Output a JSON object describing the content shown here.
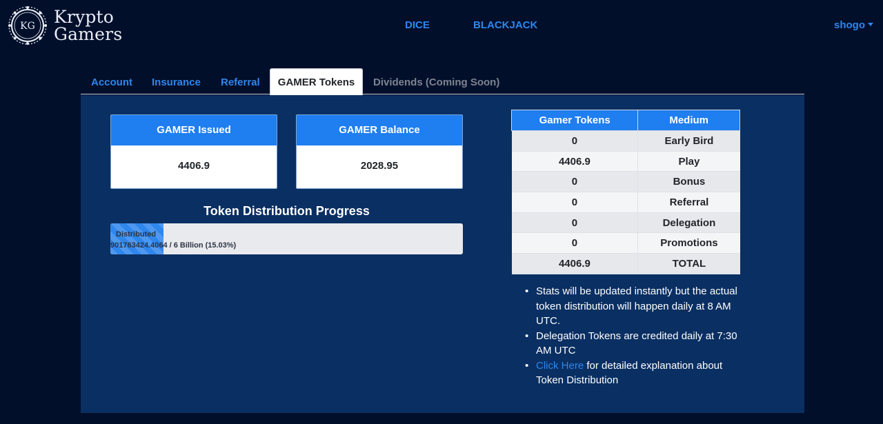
{
  "brand": {
    "badge": "KG",
    "line1": "Krypto",
    "line2": "Gamers"
  },
  "nav": {
    "dice": "DICE",
    "blackjack": "BLACKJACK",
    "user": "shogo"
  },
  "tabs": [
    {
      "label": "Account",
      "active": false
    },
    {
      "label": "Insurance",
      "active": false
    },
    {
      "label": "Referral",
      "active": false
    },
    {
      "label": "GAMER Tokens",
      "active": true
    },
    {
      "label": "Dividends (Coming Soon)",
      "active": false,
      "disabled": true
    }
  ],
  "stats": {
    "issued": {
      "label": "GAMER Issued",
      "value": "4406.9"
    },
    "balance": {
      "label": "GAMER Balance",
      "value": "2028.95"
    }
  },
  "progress": {
    "title": "Token Distribution Progress",
    "line1": "Distributed",
    "line2": "901763424.4064 / 6 Billion (15.03%)",
    "percent": 15.03
  },
  "table": {
    "headers": [
      "Gamer Tokens",
      "Medium"
    ],
    "rows": [
      [
        "0",
        "Early Bird"
      ],
      [
        "4406.9",
        "Play"
      ],
      [
        "0",
        "Bonus"
      ],
      [
        "0",
        "Referral"
      ],
      [
        "0",
        "Delegation"
      ],
      [
        "0",
        "Promotions"
      ],
      [
        "4406.9",
        "TOTAL"
      ]
    ]
  },
  "notes": {
    "n1": "Stats will be updated instantly but the actual token distribution will happen daily at 8 AM UTC.",
    "n2": "Delegation Tokens are credited daily at 7:30 AM UTC",
    "link": "Click Here",
    "n3_rest": " for detailed explanation about Token Distribution"
  },
  "colors": {
    "background": "#020f2b",
    "panel": "#0a2f62",
    "accent": "#1f7ef0",
    "link": "#2f86ec"
  }
}
